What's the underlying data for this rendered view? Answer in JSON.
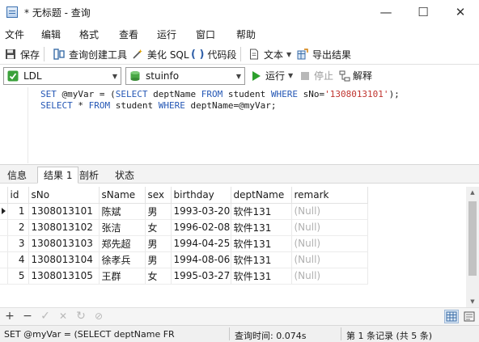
{
  "window": {
    "title": "* 无标题 - 查询",
    "minimize": "—",
    "maximize": "☐",
    "close": "✕"
  },
  "menu": [
    "文件",
    "编辑",
    "格式",
    "查看",
    "运行",
    "窗口",
    "帮助"
  ],
  "toolbar": {
    "save": "保存",
    "query_builder": "查询创建工具",
    "beautify": "美化 SQL",
    "snippet": "代码段",
    "text": "文本",
    "export": "导出结果"
  },
  "toolbar2": {
    "connection": "LDL",
    "database": "stuinfo",
    "run": "运行",
    "stop": "停止",
    "explain": "解释"
  },
  "editor": {
    "lines": [
      "SET @myVar = (SELECT deptName FROM student WHERE sNo='1308013101');",
      "SELECT * FROM student WHERE deptName=@myVar;"
    ]
  },
  "tabs": [
    "信息",
    "结果 1",
    "剖析",
    "状态"
  ],
  "active_tab": "结果 1",
  "grid": {
    "columns": [
      "id",
      "sNo",
      "sName",
      "sex",
      "birthday",
      "deptName",
      "remark"
    ],
    "rows": [
      [
        "1",
        "1308013101",
        "陈斌",
        "男",
        "1993-03-20",
        "软件131",
        "(Null)"
      ],
      [
        "2",
        "1308013102",
        "张洁",
        "女",
        "1996-02-08",
        "软件131",
        "(Null)"
      ],
      [
        "3",
        "1308013103",
        "郑先超",
        "男",
        "1994-04-25",
        "软件131",
        "(Null)"
      ],
      [
        "4",
        "1308013104",
        "徐孝兵",
        "男",
        "1994-08-06",
        "软件131",
        "(Null)"
      ],
      [
        "5",
        "1308013105",
        "王群",
        "女",
        "1995-03-27",
        "软件131",
        "(Null)"
      ]
    ]
  },
  "gridbar": {
    "add": "+",
    "remove": "−",
    "apply": "✓",
    "discard": "✕",
    "refresh": "↻",
    "stop": "⊘"
  },
  "status": {
    "sql": "SET @myVar = (SELECT deptName FR",
    "query_time": "查询时间: 0.074s",
    "records": "第 1 条记录 (共 5 条)"
  },
  "colors": {
    "keyword": "#2457b5",
    "string": "#c0342f",
    "run_green": "#2ca02c",
    "null_text": "#b0b0b0"
  }
}
